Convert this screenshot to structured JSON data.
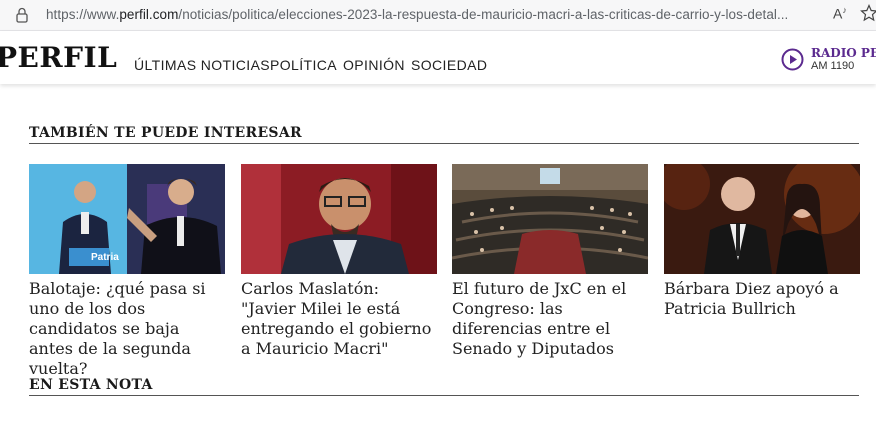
{
  "browser": {
    "url_prefix": "https://www.",
    "url_domain": "perfil.com",
    "url_path": "/noticias/politica/elecciones-2023-la-respuesta-de-mauricio-macri-a-las-criticas-de-carrio-y-los-detal...",
    "reader_icon": "reader-mode-icon",
    "reader_text": "A",
    "reader_sup": "♪"
  },
  "site": {
    "logo": "PERFIL",
    "nav": [
      "ÚLTIMAS NOTICIAS",
      "POLÍTICA",
      "OPINIÓN",
      "SOCIEDAD"
    ],
    "radio_name": "RADIO PERFIL",
    "radio_freq": "AM 1190"
  },
  "sections": {
    "related_title": "TAMBIÉN TE PUEDE INTERESAR",
    "note_title": "EN ESTA NOTA"
  },
  "cards": [
    {
      "title": "Balotaje: ¿qué pasa si uno de los dos candidatos se baja antes de la segunda vuelta?",
      "thumb_label": "Patria"
    },
    {
      "title": "Carlos Maslatón: \"Javier Milei le está entregando el gobierno a Mauricio Macri\""
    },
    {
      "title": "El futuro de JxC en el Congreso: las diferencias entre el Senado y Diputados"
    },
    {
      "title": "Bárbara Diez apoyó a Patricia Bullrich"
    }
  ],
  "colors": {
    "radio_accent": "#5b2a8f",
    "link_text": "#222222"
  }
}
